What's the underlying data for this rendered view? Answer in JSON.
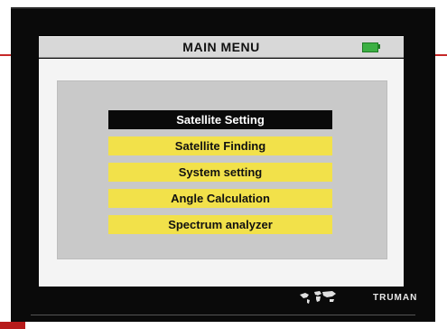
{
  "header": {
    "title": "MAIN MENU"
  },
  "menu": {
    "items": [
      {
        "label": "Satellite Setting",
        "selected": true
      },
      {
        "label": "Satellite Finding",
        "selected": false
      },
      {
        "label": "System setting",
        "selected": false
      },
      {
        "label": "Angle Calculation",
        "selected": false
      },
      {
        "label": "Spectrum analyzer",
        "selected": false
      }
    ]
  },
  "footer": {
    "brand": "TRUMAN"
  },
  "icons": {
    "battery": "battery-icon",
    "world": "world-map-icon"
  },
  "colors": {
    "menu_item_bg": "#f2e14a",
    "selected_bg": "#0a0a0a",
    "battery": "#3cb043"
  }
}
